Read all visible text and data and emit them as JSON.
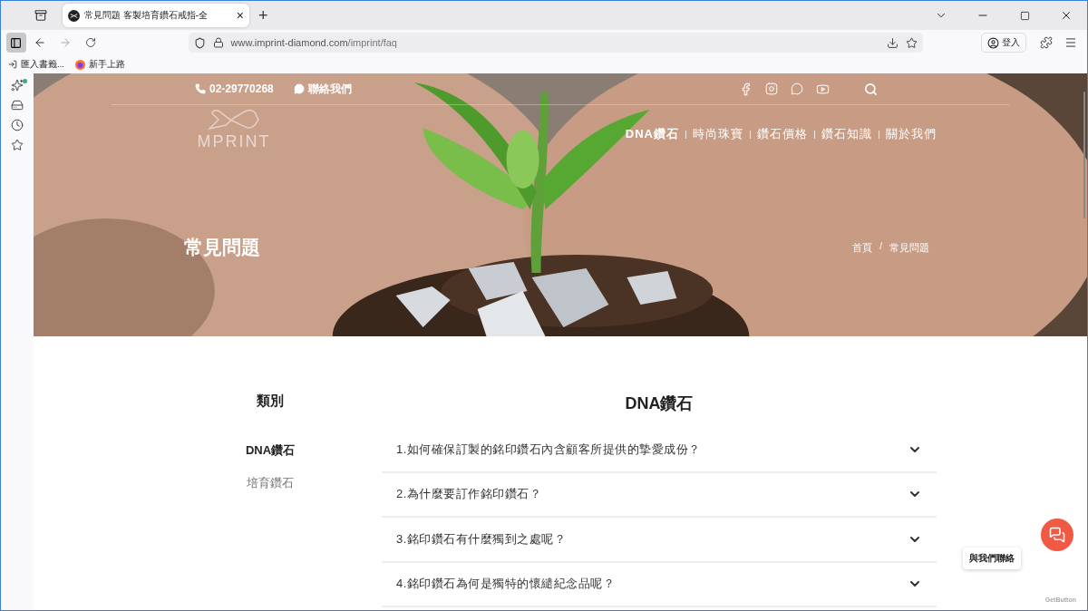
{
  "browser": {
    "tab": {
      "title": "常見問題 客製培育鑽石戒指-全",
      "close": "×",
      "selected": true
    },
    "new_tab": "+",
    "url": {
      "host": "www.imprint-diamond.com",
      "path": "/imprint/faq"
    },
    "sign_in": "登入",
    "bookmarks": [
      {
        "label": "匯入書籤..."
      },
      {
        "label": "新手上路"
      }
    ]
  },
  "site": {
    "phone": "02-29770268",
    "contact": "聯絡我們",
    "logo": "MPRINT",
    "nav": [
      {
        "label": "DNA鑽石",
        "selected": true
      },
      {
        "label": "時尚珠寶",
        "selected": false
      },
      {
        "label": "鑽石價格",
        "selected": false
      },
      {
        "label": "鑽石知識",
        "selected": false
      },
      {
        "label": "關於我們",
        "selected": false
      }
    ],
    "page_title": "常見問題",
    "breadcrumb": [
      "首頁",
      "常見問題"
    ],
    "breadcrumb_separator": "/",
    "categories": {
      "title": "類別",
      "items": [
        {
          "label": "DNA鑽石",
          "selected": true
        },
        {
          "label": "培育鑽石",
          "selected": false
        }
      ]
    },
    "faq": {
      "title": "DNA鑽石",
      "items": [
        {
          "question": "1.如何確保訂製的銘印鑽石內含顧客所提供的摯愛成份？",
          "expanded": false
        },
        {
          "question": "2.為什麼要訂作銘印鑽石？",
          "expanded": false
        },
        {
          "question": "3.銘印鑽石有什麼獨到之處呢？",
          "expanded": false
        },
        {
          "question": "4.銘印鑽石為何是獨特的懷繾紀念品呢？",
          "expanded": false
        }
      ]
    },
    "chat": {
      "tooltip": "與我們聯絡",
      "brand": "GetButton"
    }
  }
}
